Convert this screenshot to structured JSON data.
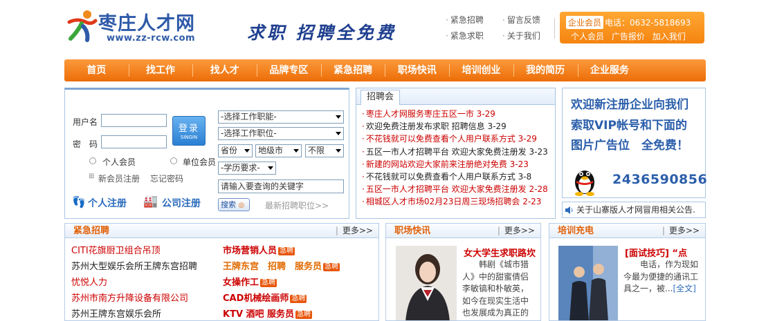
{
  "header": {
    "logo_text": "枣庄人才网",
    "logo_url": "www.zz-rcw.com",
    "slogan": "求职 招聘全免费",
    "quick_links": [
      "紧急招聘",
      "留言反馈",
      "紧急求职",
      "关于我们"
    ],
    "member": {
      "tag": "企业会员",
      "tel": "电话：0632-5818693",
      "links": [
        "个人会员",
        "广告报价",
        "加入我们"
      ]
    }
  },
  "nav": [
    "首页",
    "找工作",
    "找人才",
    "品牌专区",
    "紧急招聘",
    "职场快讯",
    "培训创业",
    "我的简历",
    "企业服务"
  ],
  "login": {
    "username_label": "用户名",
    "password_label": "密　码",
    "login_button": "登录",
    "login_button_sub": "SINGIN",
    "radio_personal": "个人会员",
    "radio_company": "单位会员",
    "register_link": "新会员注册",
    "forgot_link": "忘记密码",
    "personal_register": "个人注册",
    "company_register": "公司注册",
    "select_function": "-选择工作职能-",
    "select_position": "-选择工作职位-",
    "select_province": "省份",
    "select_city": "地级市",
    "select_area": "不限",
    "select_education": "-学历要求-",
    "keyword_value": "请输入要查询的关键字",
    "search_button": "搜索",
    "latest_link": "最新招聘职位>>"
  },
  "job_fair": {
    "tab": "招聘会",
    "items": [
      {
        "text": "枣庄人才网服务枣庄五区一市",
        "date": "3-29",
        "red": true
      },
      {
        "text": "欢迎免费注册发布求职 招聘信息",
        "date": "3-29",
        "red": false
      },
      {
        "text": "不花钱就可以免费查看个人用户联系方式",
        "date": "3-29",
        "red": true
      },
      {
        "text": "五区一市人才招聘平台 欢迎大家免费注册发",
        "date": "3-23",
        "red": false
      },
      {
        "text": "新建的网站欢迎大家前来注册绝对免费",
        "date": "3-23",
        "red": true
      },
      {
        "text": "不花钱就可以免费查看个人用户联系方式",
        "date": "3-8",
        "red": false
      },
      {
        "text": "五区一市人才招聘平台 欢迎大家免费注册发",
        "date": "2-28",
        "red": true
      },
      {
        "text": "相城区人才市场02月23日周三现场招聘会",
        "date": "2-23",
        "red": false
      }
    ]
  },
  "ad": {
    "lines": [
      "欢迎新注册企业向我们",
      "索取VIP帐号和下面的",
      "图片广告位　全免费！"
    ],
    "qq": "2436590856",
    "notice": "关于山寨版人才网冒用相关公告."
  },
  "urgent": {
    "title": "紧急招聘",
    "more": "更多>>",
    "hot_label": "急聘",
    "rows": [
      {
        "left": "CITI花旗厨卫组合吊顶",
        "left_red": true,
        "right": "市场营销人员"
      },
      {
        "left": "苏州大型娱乐会所王牌东宫招聘",
        "left_red": false,
        "right": "王牌东宫　招聘　服务员"
      },
      {
        "left": "忧悦人力",
        "left_red": true,
        "right": "女操作工"
      },
      {
        "left": "苏州市南方升降设备有限公司",
        "left_red": true,
        "right": "CAD机械绘画师"
      },
      {
        "left": "苏州王牌东宫娱乐会所",
        "left_red": false,
        "right": "KTV 酒吧 服务员"
      }
    ]
  },
  "news": {
    "title": "职场快讯",
    "more": "更多>>",
    "headline": "女大学生求职路坎",
    "body": "韩剧《城市猎人》中的甜蜜倩侣李敏镐和朴敏英，如今在现实生活中也发展成为真正的恋人，据小道"
  },
  "training": {
    "title": "培训充电",
    "more": "更多>>",
    "headline": "[面试技巧] “点",
    "body": "电话，作为现如今最为便捷的通讯工具之一，被...",
    "full_link": "[全文]"
  }
}
